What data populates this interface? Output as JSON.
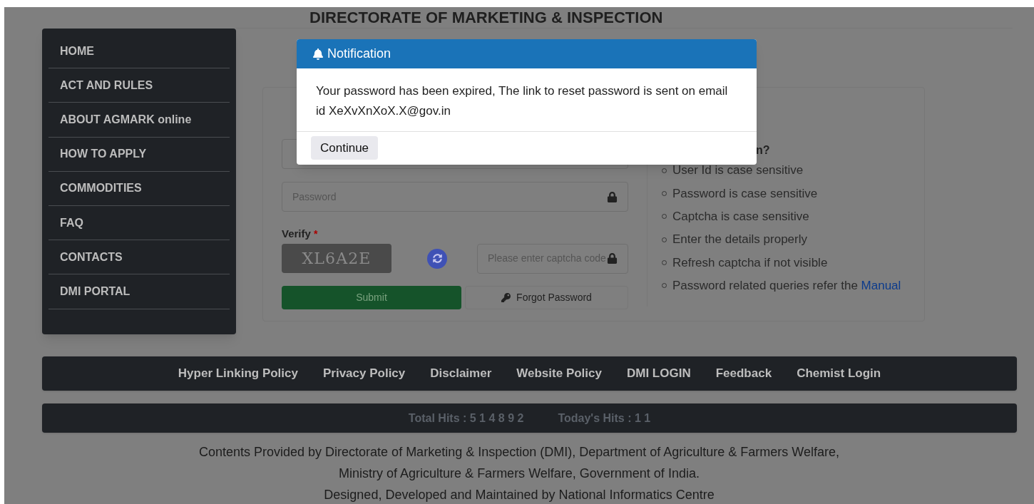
{
  "header": {
    "title": "DIRECTORATE OF MARKETING & INSPECTION"
  },
  "sidebar": {
    "items": [
      {
        "label": "HOME"
      },
      {
        "label": "ACT AND RULES"
      },
      {
        "label": "ABOUT AGMARK online"
      },
      {
        "label": "HOW TO APPLY"
      },
      {
        "label": "COMMODITIES"
      },
      {
        "label": "FAQ"
      },
      {
        "label": "CONTACTS"
      },
      {
        "label": "DMI PORTAL"
      }
    ]
  },
  "login": {
    "password_placeholder": "Password",
    "verify_label": "Verify",
    "required_mark": "*",
    "captcha_text": "XL6A2E",
    "captcha_placeholder": "Please enter captcha code",
    "submit": "Submit",
    "forgot": "Forgot Password",
    "help_heading": "n?",
    "help_items": [
      "User Id is case sensitive",
      "Password is case sensitive",
      "Captcha is case sensitive",
      "Enter the details properly",
      "Refresh captcha if not visible",
      "Password related queries refer the "
    ],
    "help_link": "Manual"
  },
  "footer_links": [
    "Hyper Linking Policy",
    "Privacy Policy",
    "Disclaimer",
    "Website Policy",
    "DMI LOGIN",
    "Feedback",
    "Chemist Login"
  ],
  "hits": [
    "Total Hits : 5 1 4 8 9 2",
    "Today's Hits : 1 1"
  ],
  "footer_text": [
    "Contents Provided by Directorate of Marketing & Inspection (DMI), Department of Agriculture & Farmers Welfare,",
    "Ministry of Agriculture & Farmers Welfare, Government of India.",
    "Designed, Developed and Maintained by National Informatics Centre"
  ],
  "dialog": {
    "title": "Notification",
    "message": "Your password has been expired, The link to reset password is sent on email id XeXvXnXoX.X@gov.in",
    "button": "Continue"
  }
}
